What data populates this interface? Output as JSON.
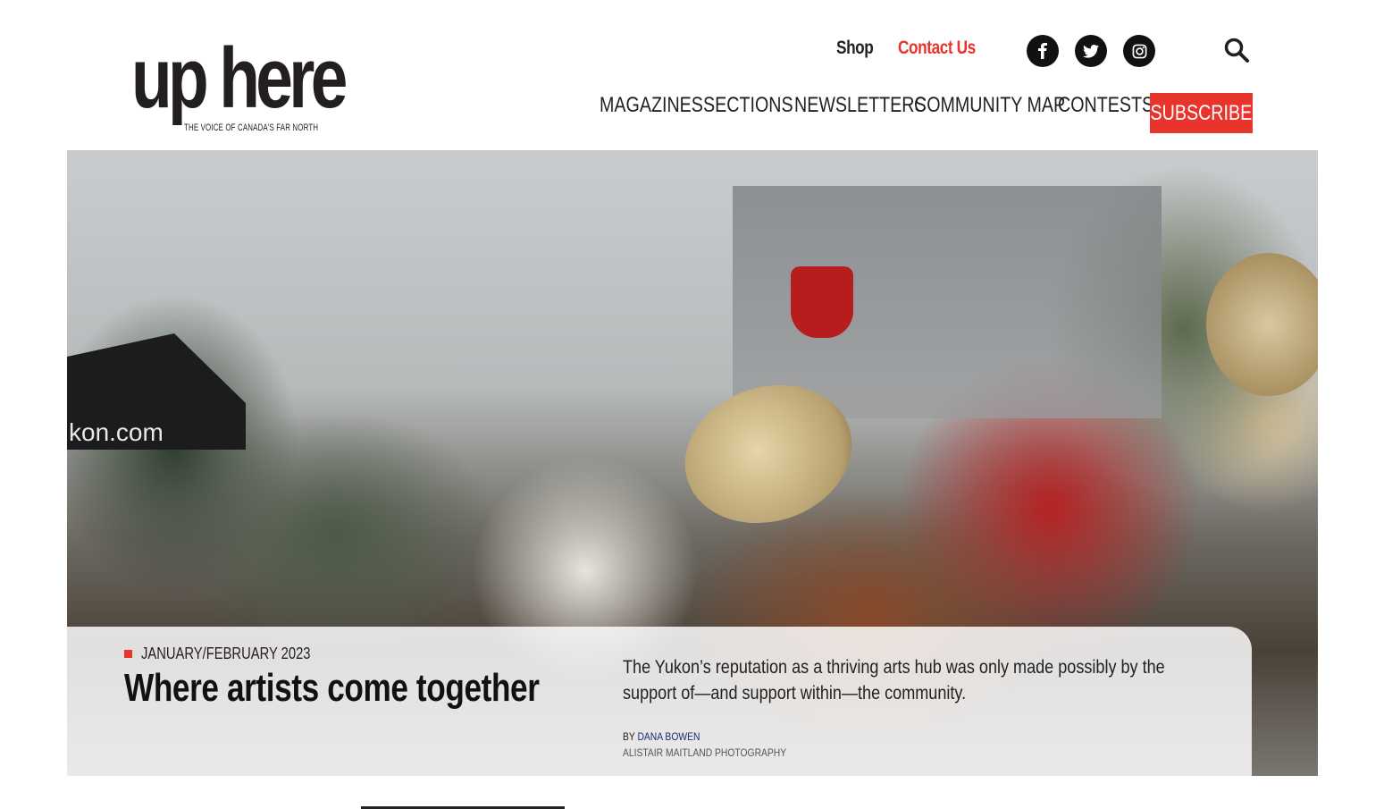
{
  "header": {
    "logo_word": "up here",
    "logo_tagline": "THE VOICE OF CANADA'S FAR NORTH",
    "top_links": {
      "shop": "Shop",
      "contact": "Contact Us"
    },
    "social": [
      "facebook-icon",
      "twitter-icon",
      "instagram-icon"
    ],
    "nav": [
      "MAGAZINES",
      "SECTIONS",
      "NEWSLETTERS",
      "COMMUNITY MAP",
      "CONTESTS"
    ],
    "subscribe": "SUBSCRIBE"
  },
  "colors": {
    "accent": "#e8342b",
    "text": "#231f20"
  },
  "hero": {
    "photo_text": "kon.com",
    "issue": "JANUARY/FEBRUARY 2023",
    "title": "Where artists come together",
    "dek": "The Yukon’s reputation as a thriving arts hub was only made possibly by the support of—and support within—the community.",
    "by_prefix": "BY",
    "author": "DANA BOWEN",
    "photo_credit": "ALISTAIR MAITLAND PHOTOGRAPHY"
  }
}
